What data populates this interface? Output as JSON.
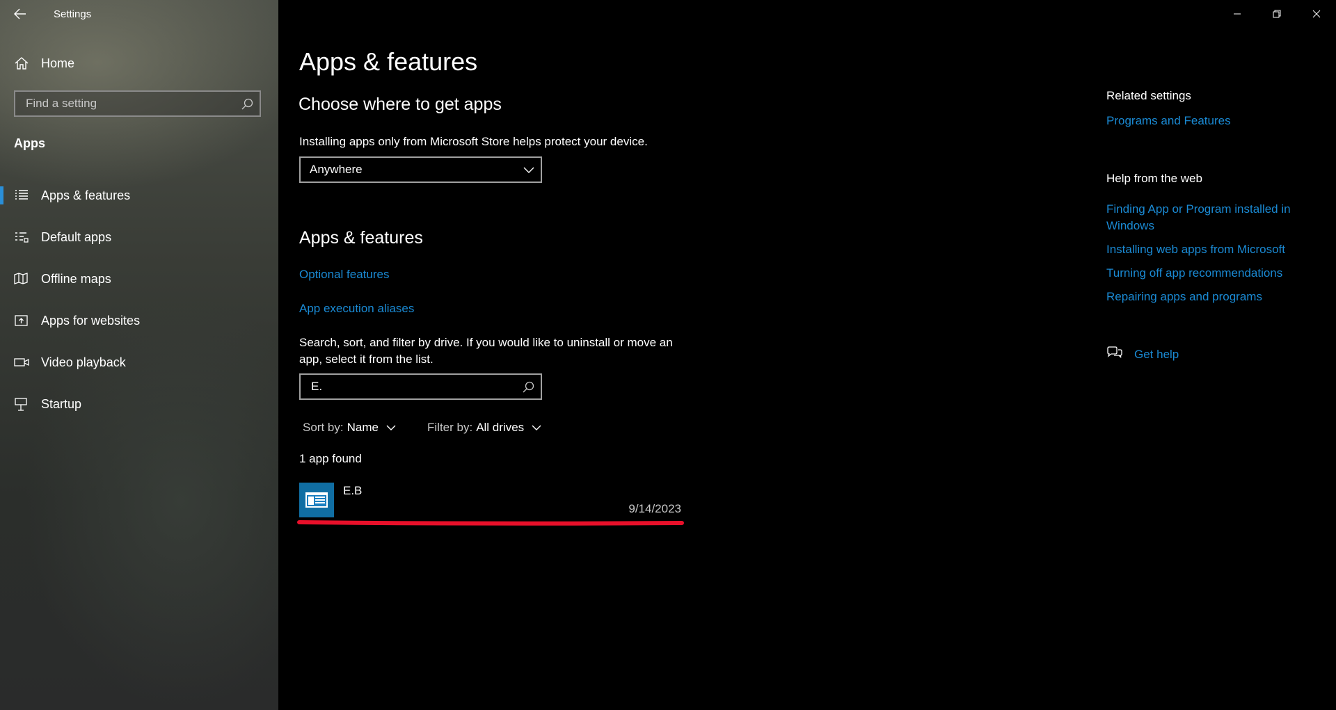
{
  "window": {
    "title": "Settings",
    "controls": [
      "minimize-icon",
      "restore-icon",
      "close-icon"
    ]
  },
  "sidebar": {
    "home_label": "Home",
    "search_placeholder": "Find a setting",
    "section": "Apps",
    "items": [
      {
        "label": "Apps & features",
        "icon": "list-icon",
        "selected": true
      },
      {
        "label": "Default apps",
        "icon": "default-apps-icon",
        "selected": false
      },
      {
        "label": "Offline maps",
        "icon": "map-icon",
        "selected": false
      },
      {
        "label": "Apps for websites",
        "icon": "website-icon",
        "selected": false
      },
      {
        "label": "Video playback",
        "icon": "video-icon",
        "selected": false
      },
      {
        "label": "Startup",
        "icon": "startup-icon",
        "selected": false
      }
    ]
  },
  "main": {
    "page_title": "Apps & features",
    "choose": {
      "heading": "Choose where to get apps",
      "description": "Installing apps only from Microsoft Store helps protect your device.",
      "selected_option": "Anywhere"
    },
    "apps_features": {
      "heading": "Apps & features",
      "link_optional": "Optional features",
      "link_aliases": "App execution aliases",
      "search_help_line1": "Search, sort, and filter by drive. If you would like to uninstall or move an",
      "search_help_line2": "app, select it from the list.",
      "search_value": "E.",
      "sort_label": "Sort by:",
      "sort_value": "Name",
      "filter_label": "Filter by:",
      "filter_value": "All drives",
      "result_count": "1 app found",
      "apps": [
        {
          "name": "E.B",
          "date": "9/14/2023"
        }
      ]
    }
  },
  "right": {
    "related_heading": "Related settings",
    "related_link": "Programs and Features",
    "help_heading": "Help from the web",
    "help_links": [
      "Finding App or Program installed in",
      "Windows",
      "Installing web apps from Microsoft",
      "Turning off app recommendations",
      "Repairing apps and programs"
    ],
    "get_help": "Get help"
  },
  "colors": {
    "accent_link": "#1a8ad4",
    "selection_bar": "#2a8fd8",
    "annotation_red": "#e8102a",
    "app_tile": "#106ea3"
  }
}
